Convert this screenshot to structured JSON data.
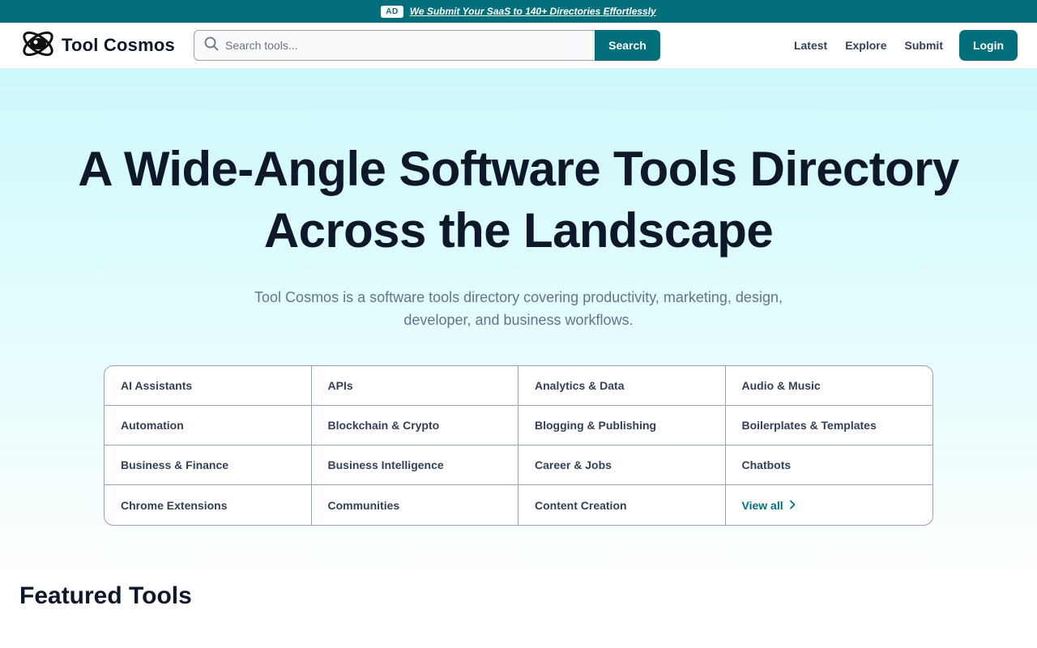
{
  "announcement": {
    "badge": "AD",
    "text": "We Submit Your SaaS to 140+ Directories Effortlessly"
  },
  "header": {
    "logo_text": "Tool Cosmos",
    "logo_icon": "planet-orbit-icon",
    "search": {
      "placeholder": "Search tools...",
      "value": "",
      "button_label": "Search"
    },
    "nav": [
      {
        "label": "Latest"
      },
      {
        "label": "Explore"
      },
      {
        "label": "Submit"
      }
    ],
    "login_label": "Login"
  },
  "hero": {
    "title": "A Wide-Angle Software Tools Directory Across the Landscape",
    "subtitle": "Tool Cosmos is a software tools directory covering productivity, marketing, design, developer, and business workflows."
  },
  "categories": [
    {
      "label": "AI Assistants"
    },
    {
      "label": "APIs"
    },
    {
      "label": "Analytics & Data"
    },
    {
      "label": "Audio & Music"
    },
    {
      "label": "Automation"
    },
    {
      "label": "Blockchain & Crypto"
    },
    {
      "label": "Blogging & Publishing"
    },
    {
      "label": "Boilerplates & Templates"
    },
    {
      "label": "Business & Finance"
    },
    {
      "label": "Business Intelligence"
    },
    {
      "label": "Career & Jobs"
    },
    {
      "label": "Chatbots"
    },
    {
      "label": "Chrome Extensions"
    },
    {
      "label": "Communities"
    },
    {
      "label": "Content Creation"
    }
  ],
  "view_all_label": "View all",
  "featured": {
    "title": "Featured Tools"
  },
  "colors": {
    "brand": "#036f7b",
    "hero_top": "#cdf9fb",
    "text_dark": "#0f172a",
    "text_muted": "#64748b"
  }
}
